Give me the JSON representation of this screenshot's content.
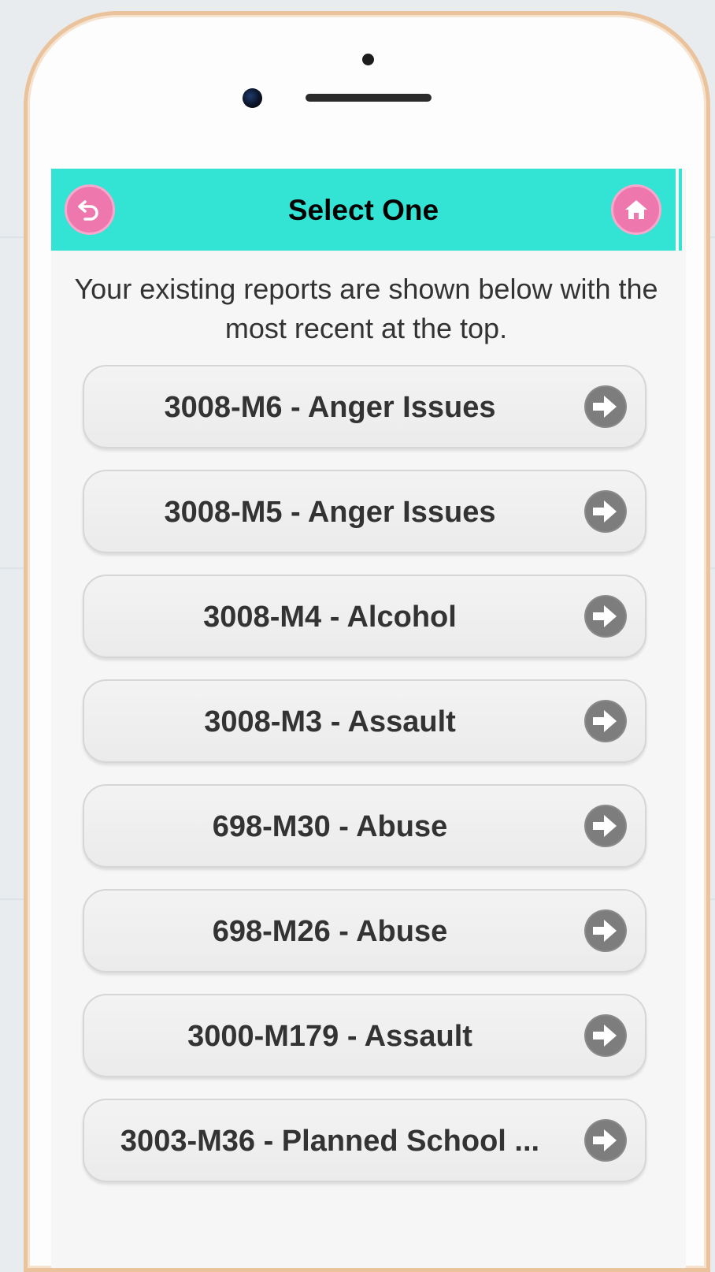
{
  "header": {
    "title": "Select One",
    "back_icon": "undo-arrow-icon",
    "home_icon": "home-icon"
  },
  "intro_text": "Your existing reports are shown below with the most recent at the top.",
  "reports": [
    {
      "label": "3008-M6 - Anger Issues"
    },
    {
      "label": "3008-M5 - Anger Issues"
    },
    {
      "label": "3008-M4 - Alcohol"
    },
    {
      "label": "3008-M3 - Assault"
    },
    {
      "label": "698-M30 - Abuse"
    },
    {
      "label": "698-M26 - Abuse"
    },
    {
      "label": "3000-M179 - Assault"
    },
    {
      "label": "3003-M36 - Planned School ..."
    }
  ],
  "colors": {
    "header_bg": "#33e3d4",
    "accent_pink": "#ee77ad",
    "row_bg": "#efefef",
    "arrow_gray": "#8a8a8a",
    "phone_frame": "#eac39c"
  }
}
